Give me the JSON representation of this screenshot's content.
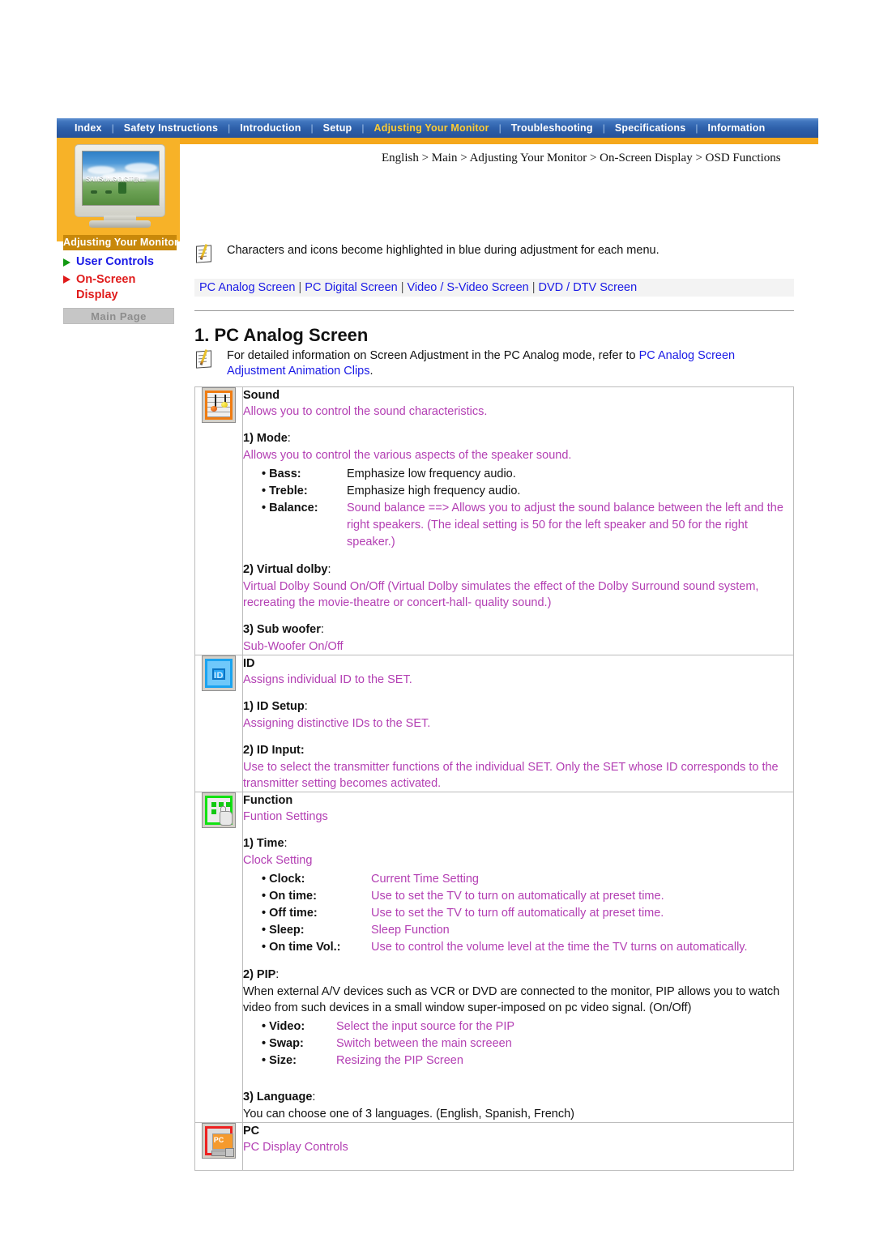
{
  "topnav": {
    "items": [
      {
        "label": "Index",
        "active": false
      },
      {
        "label": "Safety Instructions",
        "active": false
      },
      {
        "label": "Introduction",
        "active": false
      },
      {
        "label": "Setup",
        "active": false
      },
      {
        "label": "Adjusting Your Monitor",
        "active": true
      },
      {
        "label": "Troubleshooting",
        "active": false
      },
      {
        "label": "Specifications",
        "active": false
      },
      {
        "label": "Information",
        "active": false
      }
    ],
    "separator": "|"
  },
  "sidebar": {
    "thumb_caption": "Adjusting Your Monitor",
    "thumb_screen_text": "SAMSUNG DIGIT@LL",
    "links": [
      {
        "label": "User Controls",
        "color": "#1a1ae6",
        "marker_color": "#119911"
      },
      {
        "label": "On-Screen",
        "label2": "Display",
        "color": "#e01b1b",
        "marker_color": "#e01b1b"
      }
    ],
    "main_page_button": "Main Page"
  },
  "breadcrumb": "English > Main > Adjusting Your Monitor > On-Screen Display > OSD Functions",
  "note_top": {
    "text": "Characters and icons become highlighted in blue during adjustment for each menu."
  },
  "linkbar": {
    "links": [
      "PC Analog Screen",
      "PC Digital Screen",
      "Video / S-Video Screen",
      "DVD / DTV Screen"
    ],
    "separator": "|"
  },
  "section": {
    "title": "1. PC Analog Screen",
    "note_prefix": "For detailed information on Screen Adjustment in the PC Analog mode, refer to ",
    "note_link": "PC Analog Screen Adjustment Animation Clips",
    "note_suffix": "."
  },
  "table": {
    "sound": {
      "icon": "sound-icon",
      "title": "Sound",
      "desc": "Allows you to control the sound characteristics.",
      "item1_label": "1) Mode",
      "item1_colon": ":",
      "item1_desc": "Allows you to control the various aspects of the speaker sound.",
      "defs": [
        {
          "term": "• Bass:",
          "desc": "Emphasize low frequency audio.",
          "color": "black"
        },
        {
          "term": "• Treble:",
          "desc": "Emphasize high frequency audio.",
          "color": "black"
        },
        {
          "term": "• Balance:",
          "desc": "Sound balance ==> Allows you to adjust the sound balance between the left and the right speakers. (The ideal setting is 50 for the left speaker and 50 for the right speaker.)",
          "color": "magenta"
        }
      ],
      "item2_label": "2) Virtual dolby",
      "item2_colon": ":",
      "item2_desc": "Virtual Dolby Sound On/Off (Virtual Dolby simulates the effect of the Dolby Surround sound system, recreating the movie-theatre or concert-hall- quality sound.)",
      "item3_label": "3) Sub woofer",
      "item3_colon": ":",
      "item3_desc": "Sub-Woofer On/Off"
    },
    "id": {
      "icon": "id-icon",
      "title": "ID",
      "desc": "Assigns individual ID to the SET.",
      "item1_label": "1) ID Setup",
      "item1_colon": ":",
      "item1_desc": "Assigning distinctive IDs to the SET.",
      "item2_label": "2) ID Input:",
      "item2_desc": "Use to select the transmitter functions of the individual SET. Only the SET whose ID corresponds to the transmitter setting becomes activated."
    },
    "function": {
      "icon": "function-icon",
      "title": "Function",
      "desc": "Funtion Settings",
      "item1_label": "1) Time",
      "item1_colon": ":",
      "item1_desc": "Clock Setting",
      "defs": [
        {
          "term": "• Clock:",
          "desc": "Current Time Setting",
          "color": "magenta"
        },
        {
          "term": "• On time:",
          "desc": "Use to set the TV to turn on automatically at preset time.",
          "color": "magenta"
        },
        {
          "term": "• Off time:",
          "desc": "Use to set the TV to turn off automatically at preset time.",
          "color": "magenta"
        },
        {
          "term": "• Sleep:",
          "desc": "Sleep Function",
          "color": "magenta"
        },
        {
          "term": "• On time Vol.:",
          "desc": "Use to control the volume level at the time the TV turns on automatically.",
          "color": "magenta"
        }
      ],
      "item2_label": "2) PIP",
      "item2_colon": ":",
      "item2_desc": "When external A/V devices such as VCR or DVD are connected to the monitor, PIP allows you to watch video from such devices in a small window super-imposed on pc video signal. (On/Off)",
      "defs2": [
        {
          "term": "• Video:",
          "desc": "Select the input source for the PIP",
          "color": "magenta"
        },
        {
          "term": "• Swap:",
          "desc": "Switch between the main screeen",
          "color": "magenta"
        },
        {
          "term": "• Size:",
          "desc": "Resizing the PIP Screen",
          "color": "magenta"
        }
      ],
      "item3_label": "3) Language",
      "item3_colon": ":",
      "item3_desc": "You can choose one of 3 languages. (English, Spanish, French)"
    },
    "pc": {
      "icon": "pc-icon",
      "title": "PC",
      "desc": "PC Display Controls"
    }
  }
}
